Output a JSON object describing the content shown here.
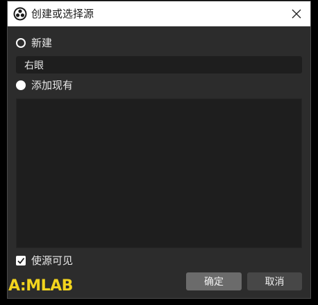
{
  "window": {
    "title": "创建或选择源",
    "app_icon": "obs-logo-icon",
    "close_icon": "close-icon"
  },
  "create_new": {
    "label": "新建",
    "checked": false,
    "name_value": "右眼"
  },
  "add_existing": {
    "label": "添加现有",
    "checked": true
  },
  "source_list": {
    "items": []
  },
  "visible_option": {
    "label": "使源可见",
    "checked": true
  },
  "buttons": {
    "ok": "确定",
    "cancel": "取消"
  },
  "watermark": {
    "text": "A:MLAB",
    "color": "#f2d41e"
  },
  "colors": {
    "background": "#2c2c2c",
    "input": "#1e1e1e",
    "ok_button": "#6b6b6b",
    "cancel_button": "#474747"
  }
}
